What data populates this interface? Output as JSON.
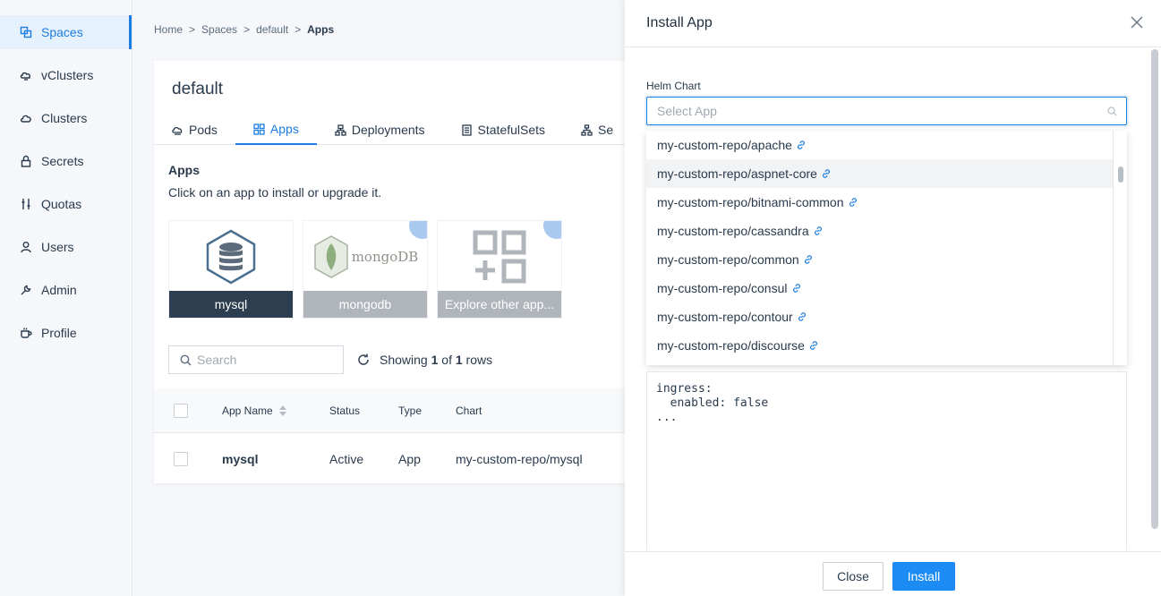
{
  "sidebar": {
    "items": [
      {
        "label": "Spaces",
        "icon": "spaces-icon"
      },
      {
        "label": "vClusters",
        "icon": "vclusters-icon"
      },
      {
        "label": "Clusters",
        "icon": "cloud-icon"
      },
      {
        "label": "Secrets",
        "icon": "lock-icon"
      },
      {
        "label": "Quotas",
        "icon": "sliders-icon"
      },
      {
        "label": "Users",
        "icon": "user-icon"
      },
      {
        "label": "Admin",
        "icon": "wrench-icon"
      },
      {
        "label": "Profile",
        "icon": "cup-icon"
      }
    ]
  },
  "breadcrumb": {
    "home": "Home",
    "sep": ">",
    "spaces": "Spaces",
    "space": "default",
    "current": "Apps"
  },
  "card": {
    "title": "default",
    "tabs": [
      {
        "label": "Pods"
      },
      {
        "label": "Apps"
      },
      {
        "label": "Deployments"
      },
      {
        "label": "StatefulSets"
      },
      {
        "label": "Se"
      }
    ],
    "apps_heading": "Apps",
    "apps_subtitle": "Click on an app to install or upgrade it.",
    "tiles": [
      {
        "label": "mysql"
      },
      {
        "label": "mongodb",
        "logo_text": "mongoDB"
      },
      {
        "label": "Explore other app..."
      }
    ],
    "search_placeholder": "Search",
    "showing": {
      "prefix": "Showing",
      "from": "1",
      "of": "of",
      "total": "1",
      "suffix": "rows"
    },
    "table": {
      "headers": {
        "name": "App Name",
        "status": "Status",
        "type": "Type",
        "chart": "Chart"
      },
      "rows": [
        {
          "name": "mysql",
          "status": "Active",
          "type": "App",
          "chart": "my-custom-repo/mysql"
        }
      ]
    }
  },
  "drawer": {
    "title": "Install App",
    "field_label": "Helm Chart",
    "select_placeholder": "Select App",
    "options": [
      "my-custom-repo/apache",
      "my-custom-repo/aspnet-core",
      "my-custom-repo/bitnami-common",
      "my-custom-repo/cassandra",
      "my-custom-repo/common",
      "my-custom-repo/consul",
      "my-custom-repo/contour",
      "my-custom-repo/discourse"
    ],
    "editor_text": "ingress:\n  enabled: false\n...",
    "close_label": "Close",
    "install_label": "Install"
  },
  "colors": {
    "accent": "#1d7de0",
    "install_button": "#1d8bf4",
    "tile_dark": "#2d3e50",
    "tile_gray": "#b0b5bc"
  }
}
